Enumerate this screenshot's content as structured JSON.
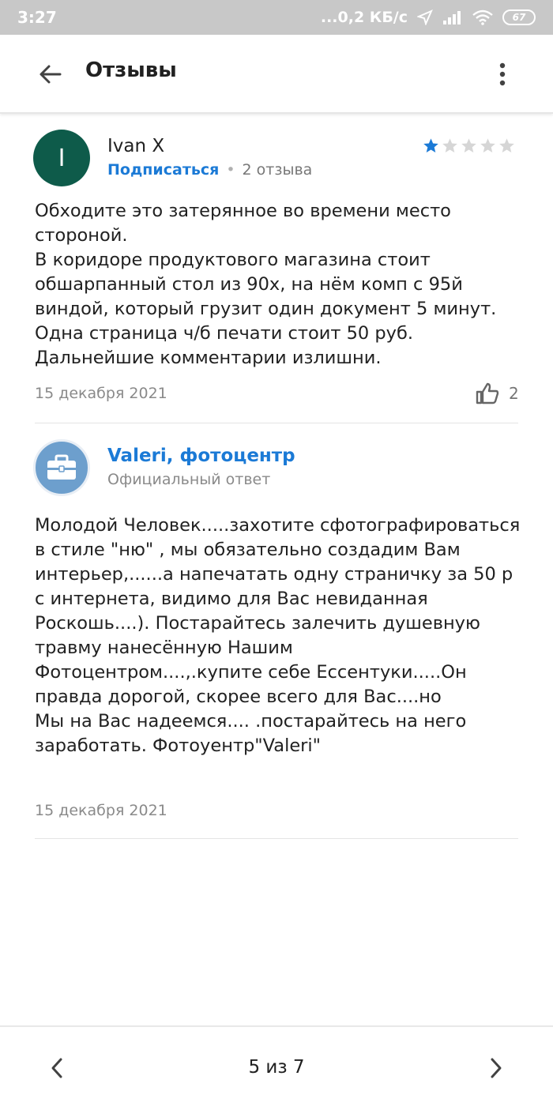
{
  "status_bar": {
    "time": "3:27",
    "network_speed": "...0,2 КБ/с",
    "battery": "67",
    "icons": [
      "location-arrow-icon",
      "signal-icon",
      "wifi-icon",
      "battery-icon"
    ]
  },
  "app_bar": {
    "title": "Отзывы",
    "back_icon": "arrow-back-icon",
    "more_icon": "more-vert-icon"
  },
  "review": {
    "avatar_letter": "I",
    "author": "Ivan X",
    "subscribe_label": "Подписаться",
    "reviews_count": "2 отзыва",
    "rating": 1,
    "rating_max": 5,
    "text": "Обходите это затерянное во времени место стороной.\nВ коридоре продуктового магазина стоит обшарпанный стол из 90х, на нём комп с 95й виндой, который грузит один документ 5 минут. Одна страница ч/б печати стоит 50 руб. Дальнейшие комментарии излишни.",
    "date": "15 декабря 2021",
    "likes": "2"
  },
  "official_reply": {
    "avatar_icon": "briefcase-icon",
    "org_name": "Valeri, фотоцентр",
    "subtitle": "Официальный ответ",
    "text": "Молодой Человек.....захотите сфотографироваться в стиле \"ню\" , мы обязательно создадим Вам интерьер,......а напечатать одну страничку за 50 р с интернета, видимо для Вас невиданная Роскошь....). Постарайтесь залечить душевную травму нанесённую Нашим Фотоцентром....,.купите себе Ессентуки.....Он правда дорогой, скорее всего для Вас....но\nМы на Вас надеемся.... .постарайтесь на него заработать. Фотоуентр\"Valeri\"",
    "date": "15 декабря 2021"
  },
  "pagination": {
    "label": "5 из 7",
    "prev_icon": "chevron-left-icon",
    "next_icon": "chevron-right-icon"
  },
  "colors": {
    "accent": "#1b7ad6",
    "star_filled": "#1b7ad6",
    "star_empty": "#d6d6d6",
    "user_avatar": "#0e5b4a",
    "org_avatar": "#6d9fcd"
  }
}
